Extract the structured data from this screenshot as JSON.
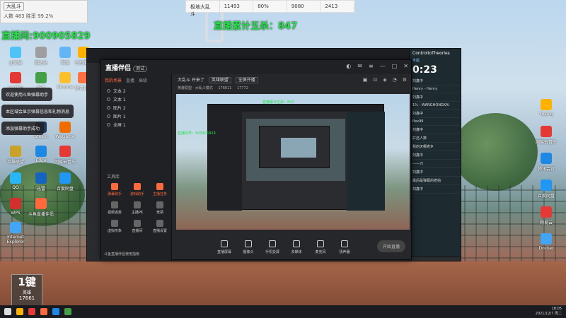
{
  "stats": {
    "pill": "大乱斗",
    "online_label": "人数",
    "online_value": "483",
    "win_label": "胜率",
    "win_value": "99.2%"
  },
  "top_table": {
    "name": "极地大乱斗",
    "games": "11493",
    "rate": "80%",
    "wins": "9080",
    "losses": "2413"
  },
  "overlay": {
    "room_id": "直播间:900905829",
    "pentakill": "直播累计五杀：847",
    "small_green": "直播间号：900905829",
    "small_green2": "直播累计五杀：847"
  },
  "tips": [
    "欢迎使用斗鱼弹幕助手",
    "本区域会显示弹幕信息和礼物消息",
    "添加弹幕助手成功"
  ],
  "app": {
    "name": "直播伴侣",
    "tag": "测试",
    "tabs": [
      "我的场景",
      "直播",
      "高级"
    ],
    "scenes": [
      "文本 2",
      "文本 1",
      "图片 2",
      "图片 1",
      "全屏 1"
    ],
    "tools_title": "工具库",
    "tools": [
      "弹幕助手",
      "游戏助手",
      "主播任务",
      "视频连麦",
      "主播PK",
      "竞猜",
      "虚拟形象",
      "直播间",
      "直播设置"
    ],
    "hint": "斗鱼直播伴侣使用指南"
  },
  "room": {
    "title": "大乱斗 开来了",
    "category": "英雄联盟",
    "edit": "全屏开播",
    "row2": "英雄联盟 · 大乱斗模式",
    "fans": "176611",
    "viewers": "17772"
  },
  "bottom": {
    "buttons": [
      "直播屏幕",
      "摄像头",
      "手机投屏",
      "多媒体",
      "麦克风",
      "扬声器"
    ],
    "start": "开始直播"
  },
  "chat": {
    "brand": "ControlioTheories",
    "sub": "专属",
    "timer": "0:23",
    "lines": [
      {
        "user": "",
        "text": "刘鑫中"
      },
      {
        "user": "",
        "text": "Henry - Henry"
      },
      {
        "user": "",
        "text": "刘鑫中"
      },
      {
        "user": "",
        "text": "1% - WANGHONGKAI"
      },
      {
        "user": "",
        "text": "刘鑫中"
      },
      {
        "user": "",
        "text": "flex99"
      },
      {
        "user": "",
        "text": "刘鑫中"
      },
      {
        "user": "",
        "text": "扛还人数"
      },
      {
        "user": "",
        "text": "我的天哪老乡"
      },
      {
        "user": "",
        "text": "刘鑫中"
      },
      {
        "user": "",
        "text": "——刀"
      },
      {
        "user": "",
        "text": "刘鑫中"
      },
      {
        "user": "",
        "text": "最后是弹幕的老拍"
      },
      {
        "user": "",
        "text": "刘鑫中"
      }
    ]
  },
  "counter": {
    "big": "1键",
    "label": "英雄",
    "num": "17661"
  },
  "desktop_icons": [
    "此电脑",
    "回收站",
    "网络",
    "控制面板",
    "QQ音乐",
    "微信",
    "Chrome",
    "腾讯视频",
    "Steam",
    "WeGame",
    "英雄联盟",
    "Edge",
    "Internet Explorer",
    "网易云音乐",
    "QQ",
    "迅雷",
    "百度网盘",
    "WPS",
    "斗鱼直播伴侣"
  ],
  "right_icons": [
    "Yy.png",
    "网易云音乐",
    "腾讯会议",
    "百度网盘",
    "网易云",
    "Docker"
  ],
  "tray": {
    "time": "18:05",
    "date": "2021/12/7 周二"
  },
  "colors": {
    "accent": "#ff6a3d",
    "green": "#27e04a"
  }
}
